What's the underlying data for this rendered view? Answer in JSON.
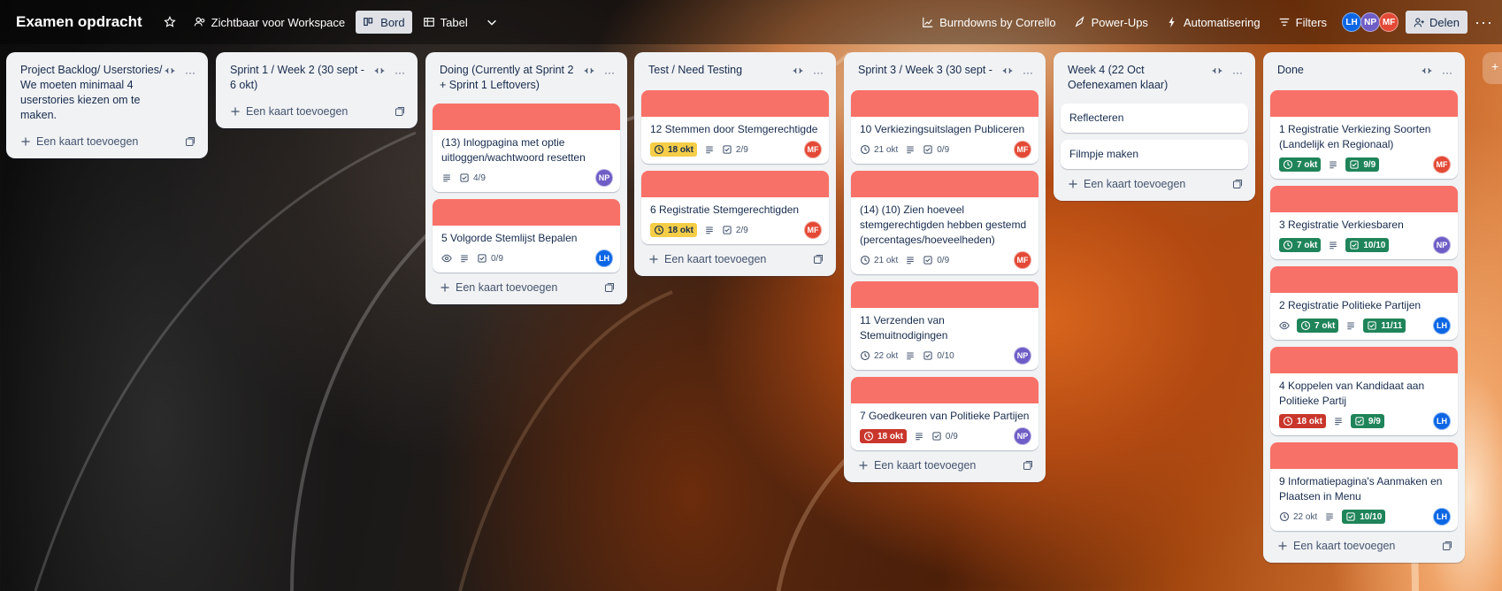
{
  "header": {
    "board_title": "Examen opdracht",
    "visibility": "Zichtbaar voor Workspace",
    "view_board": "Bord",
    "view_table": "Tabel",
    "powerup_burndown": "Burndowns by Corrello",
    "powerups": "Power-Ups",
    "automation": "Automatisering",
    "filters": "Filters",
    "share": "Delen",
    "members": [
      {
        "initials": "LH",
        "color": "#0c66e4"
      },
      {
        "initials": "NP",
        "color": "#6e5dc6"
      },
      {
        "initials": "MF",
        "color": "#e34935"
      }
    ]
  },
  "add_card_label": "Een kaart toevoegen",
  "lists": [
    {
      "title": "Project Backlog/ Userstories/ We moeten minimaal 4 userstories kiezen om te maken.",
      "cards": []
    },
    {
      "title": "Sprint 1 / Week 2 (30 sept - 6 okt)",
      "cards": []
    },
    {
      "title": "Doing (Currently at Sprint 2 + Sprint 1 Leftovers)",
      "cards": [
        {
          "title": "(13) Inlogpagina met optie uitloggen/wachtwoord resetten",
          "checklist": "4/9",
          "member": "NP"
        },
        {
          "title": "5 Volgorde Stemlijst Bepalen",
          "checklist": "0/9",
          "member": "LH"
        }
      ]
    },
    {
      "title": "Test / Need Testing",
      "cards": [
        {
          "title": "12 Stemmen door Stemgerechtigde",
          "due": "18 okt",
          "checklist": "2/9",
          "member": "MF"
        },
        {
          "title": "6 Registratie Stemgerechtigden",
          "due": "18 okt",
          "checklist": "2/9",
          "member": "MF"
        }
      ]
    },
    {
      "title": "Sprint 3 / Week 3 (30 sept -",
      "cards": [
        {
          "title": "10 Verkiezingsuitslagen Publiceren",
          "due": "21 okt",
          "checklist": "0/9",
          "member": "MF"
        },
        {
          "title": "(14) (10) Zien hoeveel stemgerechtigden hebben gestemd (percentages/hoeveelheden)",
          "due": "21 okt",
          "checklist": "0/9",
          "member": "MF"
        },
        {
          "title": "11 Verzenden van Stemuitnodigingen",
          "due": "22 okt",
          "checklist": "0/10",
          "member": "NP"
        },
        {
          "title": "7 Goedkeuren van Politieke Partijen",
          "due": "18 okt",
          "checklist": "0/9",
          "member": "NP"
        }
      ]
    },
    {
      "title": "Week 4 (22 Oct Oefenexamen klaar)",
      "cards": [
        {
          "title": "Reflecteren"
        },
        {
          "title": "Filmpje maken"
        }
      ]
    },
    {
      "title": "Done",
      "cards": [
        {
          "title": "1 Registratie Verkiezing Soorten (Landelijk en Regionaal)",
          "due": "7 okt",
          "checklist": "9/9",
          "member": "MF"
        },
        {
          "title": "3 Registratie Verkiesbaren",
          "due": "7 okt",
          "checklist": "10/10",
          "member": "NP"
        },
        {
          "title": "2 Registratie Politieke Partijen",
          "due": "7 okt",
          "checklist": "11/11",
          "member": "LH"
        },
        {
          "title": "4 Koppelen van Kandidaat aan Politieke Partij",
          "due": "18 okt",
          "checklist": "9/9",
          "member": "LH"
        },
        {
          "title": "9 Informatiepagina's Aanmaken en Plaatsen in Menu",
          "due": "22 okt",
          "checklist": "10/10",
          "member": "LH"
        }
      ]
    }
  ],
  "colors": {
    "cover": "#f87168",
    "due_soon": "#f5cd47",
    "overdue": "#c9372c",
    "complete": "#1f845a"
  }
}
